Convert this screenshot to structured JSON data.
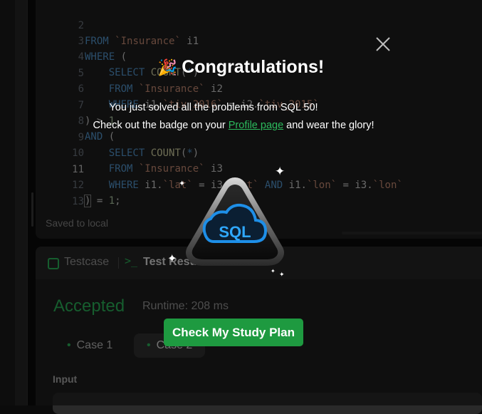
{
  "editor": {
    "lines": [
      {
        "num": "2"
      },
      {
        "num": "3"
      },
      {
        "num": "4"
      },
      {
        "num": "5"
      },
      {
        "num": "6"
      },
      {
        "num": "7"
      },
      {
        "num": "8"
      },
      {
        "num": "9"
      },
      {
        "num": "10"
      },
      {
        "num": "11"
      },
      {
        "num": "12"
      },
      {
        "num": "13"
      }
    ],
    "saved_status": "Saved to local"
  },
  "bottom_panel": {
    "tabs": [
      {
        "label": "Testcase",
        "icon": "checkbox-icon"
      },
      {
        "label": "Test Result",
        "icon": "terminal-icon"
      }
    ],
    "status": "Accepted",
    "runtime": "Runtime: 208 ms",
    "cases": [
      {
        "label": "Case 1"
      },
      {
        "label": "Case 2"
      }
    ],
    "input_label": "Input"
  },
  "modal": {
    "title": "Congratulations!",
    "title_icon": "party-popper-icon",
    "message_line1": "You just solved all the problems from SQL 50!",
    "message_line2_prefix": "Check out the badge on your",
    "profile_link": "Profile page",
    "message_line2_suffix": "and wear the glory!",
    "badge_text": "SQL",
    "cta_label": "Check My Study Plan",
    "close_icon": "close-icon"
  },
  "colors": {
    "accent_green": "#2cbb5d",
    "button_green": "#1e9a40",
    "badge_blue": "#1e8fe8"
  }
}
